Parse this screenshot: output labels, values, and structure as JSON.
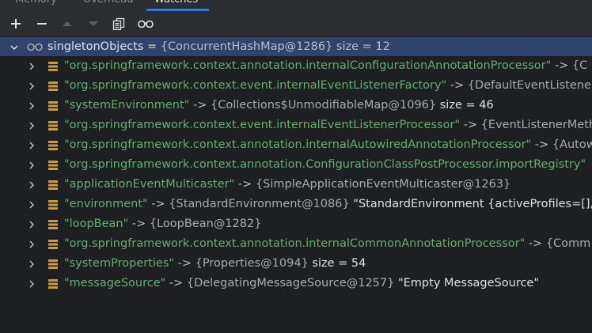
{
  "tabs": [
    {
      "label": "Memory"
    },
    {
      "label": "Overhead"
    },
    {
      "label": "Watches",
      "active": true
    }
  ],
  "toolbar": {
    "icons": [
      "add-icon",
      "remove-icon",
      "move-up-icon",
      "move-down-icon",
      "copy-icon",
      "glasses-icon"
    ]
  },
  "root": {
    "name": "singletonObjects",
    "eq": " = ",
    "type": "{ConcurrentHashMap@1286}",
    "extra": "  size = 12"
  },
  "entries": [
    {
      "key": "\"org.springframework.context.annotation.internalConfigurationAnnotationProcessor\"",
      "arrow": " -> ",
      "type": "{C",
      "extra": ""
    },
    {
      "key": "\"org.springframework.context.event.internalEventListenerFactory\"",
      "arrow": " -> ",
      "type": "{DefaultEventListenerF",
      "extra": ""
    },
    {
      "key": "\"systemEnvironment\"",
      "arrow": " -> ",
      "type": "{Collections$UnmodifiableMap@1096}",
      "extra": "  size = 46"
    },
    {
      "key": "\"org.springframework.context.event.internalEventListenerProcessor\"",
      "arrow": " -> ",
      "type": "{EventListenerMeth",
      "extra": ""
    },
    {
      "key": "\"org.springframework.context.annotation.internalAutowiredAnnotationProcessor\"",
      "arrow": " -> ",
      "type": "{Autow",
      "extra": ""
    },
    {
      "key": "\"org.springframework.context.annotation.ConfigurationClassPostProcessor.importRegistry\"",
      "arrow": "",
      "type": "",
      "extra": ""
    },
    {
      "key": "\"applicationEventMulticaster\"",
      "arrow": " -> ",
      "type": "{SimpleApplicationEventMulticaster@1263}",
      "extra": ""
    },
    {
      "key": "\"environment\"",
      "arrow": " -> ",
      "type": "{StandardEnvironment@1086}",
      "extra": " \"StandardEnvironment {activeProfiles=[], de"
    },
    {
      "key": "\"loopBean\"",
      "arrow": " -> ",
      "type": "{LoopBean@1282}",
      "extra": ""
    },
    {
      "key": "\"org.springframework.context.annotation.internalCommonAnnotationProcessor\"",
      "arrow": " -> ",
      "type": "{Comm",
      "extra": ""
    },
    {
      "key": "\"systemProperties\"",
      "arrow": " -> ",
      "type": "{Properties@1094}",
      "extra": "  size = 54"
    },
    {
      "key": "\"messageSource\"",
      "arrow": " -> ",
      "type": "{DelegatingMessageSource@1257}",
      "extra": " \"Empty MessageSource\""
    }
  ],
  "colors": {
    "background": "#1e1f22",
    "toolbar": "#2b2d30",
    "selection": "#2e436e",
    "string_key": "#6aab73",
    "map_icon": "#c79a48",
    "accent": "#3574f0"
  }
}
